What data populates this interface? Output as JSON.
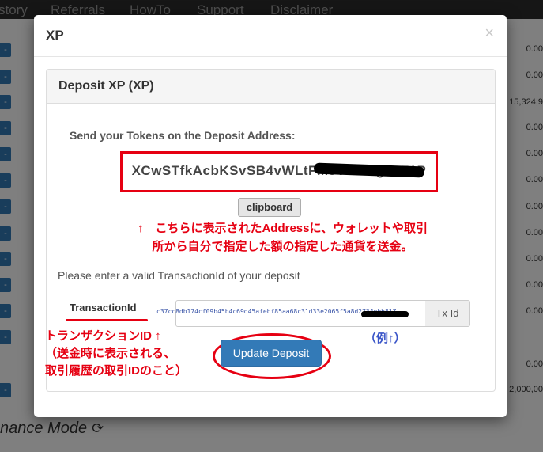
{
  "background": {
    "nav": [
      "story",
      "Referrals",
      "HowTo",
      "Support",
      "Disclaimer"
    ],
    "row_button": "-",
    "numbers": [
      "0.00",
      "0.00",
      "15,324,9",
      "0.00",
      "0.00",
      "0.00",
      "0.00",
      "0.00",
      "0.00",
      "0.00",
      "0.00",
      "0.00",
      "2,000,00"
    ],
    "footer": "nance Mode",
    "footer_icon": "refresh-icon"
  },
  "modal": {
    "title": "XP",
    "close": "×",
    "panel_title": "Deposit XP (XP)",
    "send_label": "Send your Tokens on the Deposit Address:",
    "address": "XCwSTfkAcbKSvSB4vWLtFM5ViVLng2cF1P",
    "clipboard": "clipboard",
    "note_line1": "↑　こちらに表示されたAddressに、ウォレットや取引",
    "note_line2": "所から自分で指定した額の指定した通貨を送金。",
    "enter_text": "Please enter a valid TransactionId of your deposit",
    "tx_label": "TransactionId",
    "tx_value": "c37cc8db174cf09b45b4c69d45afebf85aa68c31d33e2065f5a8d2734ebb817",
    "tx_addon": "Tx Id",
    "example": "（例↑）",
    "txid_note1": "トランザクションID ↑",
    "txid_note2": "（送金時に表示される、",
    "txid_note3": "取引履歴の取引IDのこと）",
    "update_button": "Update Deposit"
  },
  "colors": {
    "accent": "#337ab7",
    "annotation_red": "#e60012",
    "annotation_blue": "#3a55c8"
  }
}
